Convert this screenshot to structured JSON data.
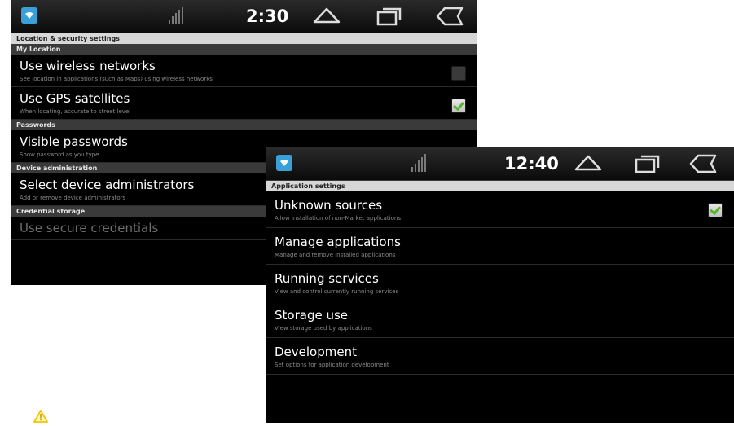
{
  "screen_a": {
    "status": {
      "time": "2:30",
      "icons": [
        "app-notification-icon",
        "signal-icon",
        "home-icon",
        "recent-apps-icon",
        "back-icon"
      ]
    },
    "header": "Location & security settings",
    "sections": [
      {
        "label": "My Location"
      },
      {
        "label": "Passwords"
      },
      {
        "label": "Device administration"
      },
      {
        "label": "Credential storage"
      }
    ],
    "items": {
      "wireless": {
        "title": "Use wireless networks",
        "summary": "See location in applications (such as Maps) using wireless networks",
        "checked": false
      },
      "gps": {
        "title": "Use GPS satellites",
        "summary": "When locating, accurate to street level",
        "checked": true
      },
      "visible_pw": {
        "title": "Visible passwords",
        "summary": "Show password as you type"
      },
      "device_admin": {
        "title": "Select device administrators",
        "summary": "Add or remove device administrators"
      },
      "secure_cred": {
        "title": "Use secure credentials",
        "enabled": false
      }
    }
  },
  "screen_b": {
    "status": {
      "time": "12:40",
      "icons": [
        "app-notification-icon",
        "signal-icon",
        "home-icon",
        "recent-apps-icon",
        "back-icon"
      ]
    },
    "header": "Application settings",
    "items": [
      {
        "title": "Unknown sources",
        "summary": "Allow installation of non-Market applications",
        "checked": true
      },
      {
        "title": "Manage applications",
        "summary": "Manage and remove installed applications"
      },
      {
        "title": "Running services",
        "summary": "View and control currently running services"
      },
      {
        "title": "Storage use",
        "summary": "View storage used by applications"
      },
      {
        "title": "Development",
        "summary": "Set options for application development"
      }
    ]
  },
  "colors": {
    "accent_blue": "#3aa0d8",
    "check_green": "#5bb130",
    "warning_yellow": "#f5c400"
  }
}
